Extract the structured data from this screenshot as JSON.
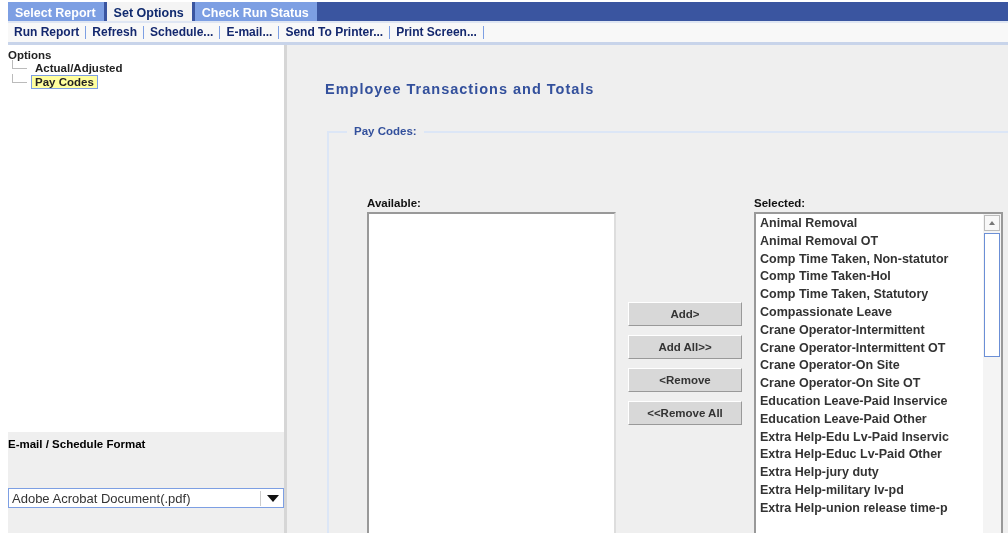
{
  "tabs": [
    {
      "label": "Select Report",
      "selected": false
    },
    {
      "label": "Set Options",
      "selected": true
    },
    {
      "label": "Check Run Status",
      "selected": false
    }
  ],
  "toolbar": [
    "Run Report",
    "Refresh",
    "Schedule...",
    "E-mail...",
    "Send To Printer...",
    "Print Screen..."
  ],
  "sidebar": {
    "title": "Options",
    "items": [
      {
        "label": "Actual/Adjusted",
        "selected": false
      },
      {
        "label": "Pay Codes",
        "selected": true
      }
    ],
    "format_label": "E-mail / Schedule Format",
    "format_value": "Adobe Acrobat Document(.pdf)"
  },
  "main": {
    "title": "Employee Transactions and Totals",
    "group_label": "Pay Codes:",
    "available_label": "Available:",
    "buttons": [
      "Add>",
      "Add All>>",
      "<Remove",
      "<<Remove All"
    ],
    "selected_label": "Selected:",
    "selected": [
      "Animal Removal",
      "Animal Removal OT",
      "Comp Time Taken, Non-statutor",
      "Comp Time Taken-Hol",
      "Comp Time Taken, Statutory",
      "Compassionate Leave",
      "Crane Operator-Intermittent",
      "Crane Operator-Intermittent OT",
      "Crane Operator-On Site",
      "Crane Operator-On Site OT",
      "Education Leave-Paid Inservice",
      "Education Leave-Paid Other",
      "Extra Help-Edu Lv-Paid Inservic",
      "Extra Help-Educ Lv-Paid Other",
      "Extra Help-jury duty",
      "Extra Help-military lv-pd",
      "Extra Help-union release time-p"
    ]
  }
}
